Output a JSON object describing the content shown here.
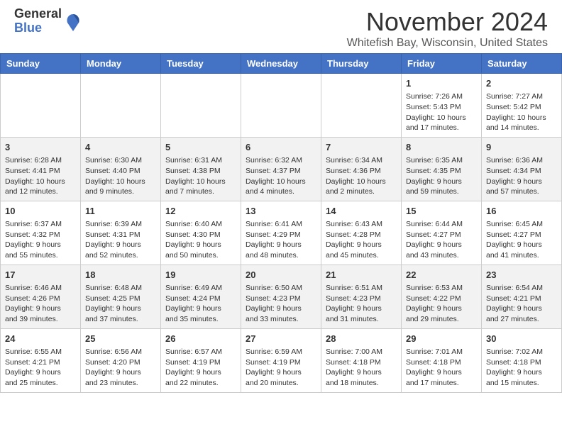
{
  "header": {
    "logo": {
      "general": "General",
      "blue": "Blue"
    },
    "title": "November 2024",
    "location": "Whitefish Bay, Wisconsin, United States"
  },
  "weekdays": [
    "Sunday",
    "Monday",
    "Tuesday",
    "Wednesday",
    "Thursday",
    "Friday",
    "Saturday"
  ],
  "rows": [
    [
      {
        "day": "",
        "info": ""
      },
      {
        "day": "",
        "info": ""
      },
      {
        "day": "",
        "info": ""
      },
      {
        "day": "",
        "info": ""
      },
      {
        "day": "",
        "info": ""
      },
      {
        "day": "1",
        "info": "Sunrise: 7:26 AM\nSunset: 5:43 PM\nDaylight: 10 hours\nand 17 minutes."
      },
      {
        "day": "2",
        "info": "Sunrise: 7:27 AM\nSunset: 5:42 PM\nDaylight: 10 hours\nand 14 minutes."
      }
    ],
    [
      {
        "day": "3",
        "info": "Sunrise: 6:28 AM\nSunset: 4:41 PM\nDaylight: 10 hours\nand 12 minutes."
      },
      {
        "day": "4",
        "info": "Sunrise: 6:30 AM\nSunset: 4:40 PM\nDaylight: 10 hours\nand 9 minutes."
      },
      {
        "day": "5",
        "info": "Sunrise: 6:31 AM\nSunset: 4:38 PM\nDaylight: 10 hours\nand 7 minutes."
      },
      {
        "day": "6",
        "info": "Sunrise: 6:32 AM\nSunset: 4:37 PM\nDaylight: 10 hours\nand 4 minutes."
      },
      {
        "day": "7",
        "info": "Sunrise: 6:34 AM\nSunset: 4:36 PM\nDaylight: 10 hours\nand 2 minutes."
      },
      {
        "day": "8",
        "info": "Sunrise: 6:35 AM\nSunset: 4:35 PM\nDaylight: 9 hours\nand 59 minutes."
      },
      {
        "day": "9",
        "info": "Sunrise: 6:36 AM\nSunset: 4:34 PM\nDaylight: 9 hours\nand 57 minutes."
      }
    ],
    [
      {
        "day": "10",
        "info": "Sunrise: 6:37 AM\nSunset: 4:32 PM\nDaylight: 9 hours\nand 55 minutes."
      },
      {
        "day": "11",
        "info": "Sunrise: 6:39 AM\nSunset: 4:31 PM\nDaylight: 9 hours\nand 52 minutes."
      },
      {
        "day": "12",
        "info": "Sunrise: 6:40 AM\nSunset: 4:30 PM\nDaylight: 9 hours\nand 50 minutes."
      },
      {
        "day": "13",
        "info": "Sunrise: 6:41 AM\nSunset: 4:29 PM\nDaylight: 9 hours\nand 48 minutes."
      },
      {
        "day": "14",
        "info": "Sunrise: 6:43 AM\nSunset: 4:28 PM\nDaylight: 9 hours\nand 45 minutes."
      },
      {
        "day": "15",
        "info": "Sunrise: 6:44 AM\nSunset: 4:27 PM\nDaylight: 9 hours\nand 43 minutes."
      },
      {
        "day": "16",
        "info": "Sunrise: 6:45 AM\nSunset: 4:27 PM\nDaylight: 9 hours\nand 41 minutes."
      }
    ],
    [
      {
        "day": "17",
        "info": "Sunrise: 6:46 AM\nSunset: 4:26 PM\nDaylight: 9 hours\nand 39 minutes."
      },
      {
        "day": "18",
        "info": "Sunrise: 6:48 AM\nSunset: 4:25 PM\nDaylight: 9 hours\nand 37 minutes."
      },
      {
        "day": "19",
        "info": "Sunrise: 6:49 AM\nSunset: 4:24 PM\nDaylight: 9 hours\nand 35 minutes."
      },
      {
        "day": "20",
        "info": "Sunrise: 6:50 AM\nSunset: 4:23 PM\nDaylight: 9 hours\nand 33 minutes."
      },
      {
        "day": "21",
        "info": "Sunrise: 6:51 AM\nSunset: 4:23 PM\nDaylight: 9 hours\nand 31 minutes."
      },
      {
        "day": "22",
        "info": "Sunrise: 6:53 AM\nSunset: 4:22 PM\nDaylight: 9 hours\nand 29 minutes."
      },
      {
        "day": "23",
        "info": "Sunrise: 6:54 AM\nSunset: 4:21 PM\nDaylight: 9 hours\nand 27 minutes."
      }
    ],
    [
      {
        "day": "24",
        "info": "Sunrise: 6:55 AM\nSunset: 4:21 PM\nDaylight: 9 hours\nand 25 minutes."
      },
      {
        "day": "25",
        "info": "Sunrise: 6:56 AM\nSunset: 4:20 PM\nDaylight: 9 hours\nand 23 minutes."
      },
      {
        "day": "26",
        "info": "Sunrise: 6:57 AM\nSunset: 4:19 PM\nDaylight: 9 hours\nand 22 minutes."
      },
      {
        "day": "27",
        "info": "Sunrise: 6:59 AM\nSunset: 4:19 PM\nDaylight: 9 hours\nand 20 minutes."
      },
      {
        "day": "28",
        "info": "Sunrise: 7:00 AM\nSunset: 4:18 PM\nDaylight: 9 hours\nand 18 minutes."
      },
      {
        "day": "29",
        "info": "Sunrise: 7:01 AM\nSunset: 4:18 PM\nDaylight: 9 hours\nand 17 minutes."
      },
      {
        "day": "30",
        "info": "Sunrise: 7:02 AM\nSunset: 4:18 PM\nDaylight: 9 hours\nand 15 minutes."
      }
    ]
  ]
}
